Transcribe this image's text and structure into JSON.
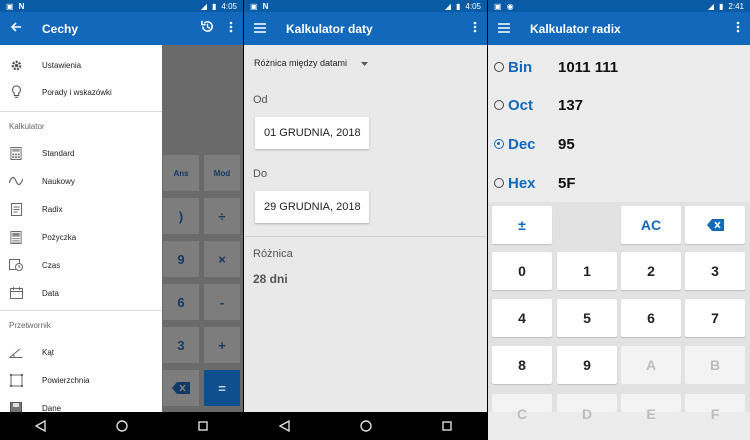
{
  "status": {
    "screen1_time": "4:05",
    "screen2_time": "4:05",
    "screen3_time": "2:41"
  },
  "screen1": {
    "title": "Cechy",
    "drawer": {
      "top_items": [
        {
          "label": "Ustawienia",
          "icon": "gear-icon"
        },
        {
          "label": "Porady i wskazówki",
          "icon": "lightbulb-icon"
        }
      ],
      "section_calc": "Kalkulator",
      "calc_items": [
        {
          "label": "Standard",
          "icon": "calculator-icon"
        },
        {
          "label": "Naukowy",
          "icon": "graph-icon"
        },
        {
          "label": "Radix",
          "icon": "document-icon"
        },
        {
          "label": "Pożyczka",
          "icon": "loan-icon"
        },
        {
          "label": "Czas",
          "icon": "clock-icon"
        },
        {
          "label": "Data",
          "icon": "calendar-icon"
        }
      ],
      "section_conv": "Przetwornik",
      "conv_items": [
        {
          "label": "Kąt",
          "icon": "angle-icon"
        },
        {
          "label": "Powierzchnia",
          "icon": "area-icon"
        },
        {
          "label": "Dane",
          "icon": "data-icon"
        }
      ]
    },
    "calc_buttons": {
      "ans": "Ans",
      "mod": "Mod",
      "close_paren": ")",
      "divide": "÷",
      "nine": "9",
      "multiply": "×",
      "six": "6",
      "minus": "-",
      "three": "3",
      "plus": "+",
      "equals": "="
    }
  },
  "screen2": {
    "title": "Kalkulator daty",
    "mode": "Różnica między datami",
    "from_label": "Od",
    "from_date": "01 GRUDNIA, 2018",
    "to_label": "Do",
    "to_date": "29 GRUDNIA, 2018",
    "diff_label": "Różnica",
    "diff_value": "28 dni"
  },
  "screen3": {
    "title": "Kalkulator radix",
    "rows": [
      {
        "name": "Bin",
        "value": "1011 111",
        "selected": false
      },
      {
        "name": "Oct",
        "value": "137",
        "selected": false
      },
      {
        "name": "Dec",
        "value": "95",
        "selected": true
      },
      {
        "name": "Hex",
        "value": "5F",
        "selected": false
      }
    ],
    "keys": {
      "plusminus": "±",
      "ac": "AC",
      "k0": "0",
      "k1": "1",
      "k2": "2",
      "k3": "3",
      "k4": "4",
      "k5": "5",
      "k6": "6",
      "k7": "7",
      "k8": "8",
      "k9": "9",
      "kA": "A",
      "kB": "B",
      "kC": "C",
      "kD": "D",
      "kE": "E",
      "kF": "F"
    }
  },
  "colors": {
    "appbar": "#1269bb",
    "statusbar": "#0a5ba6",
    "accent": "#1269bb"
  }
}
